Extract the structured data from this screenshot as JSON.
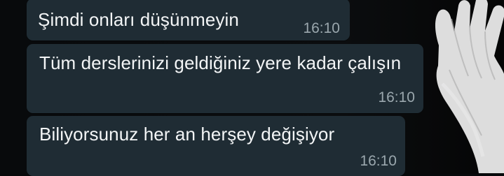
{
  "messages": [
    {
      "text": "Şimdi onları düşünmeyin",
      "time": "16:10"
    },
    {
      "text": "Tüm derslerinizi geldiğiniz yere kadar çalışın",
      "time": "16:10"
    },
    {
      "text": "Biliyorsunuz her an herşey değişiyor",
      "time": "16:10"
    }
  ],
  "colors": {
    "background": "#07090b",
    "bubble": "#1f2c34",
    "message_text": "#f3f5f6",
    "timestamp": "#9aa7ad",
    "hand": "#e6e6e6"
  },
  "wallpaper": {
    "icon": "raised-hand-wallpaper"
  }
}
